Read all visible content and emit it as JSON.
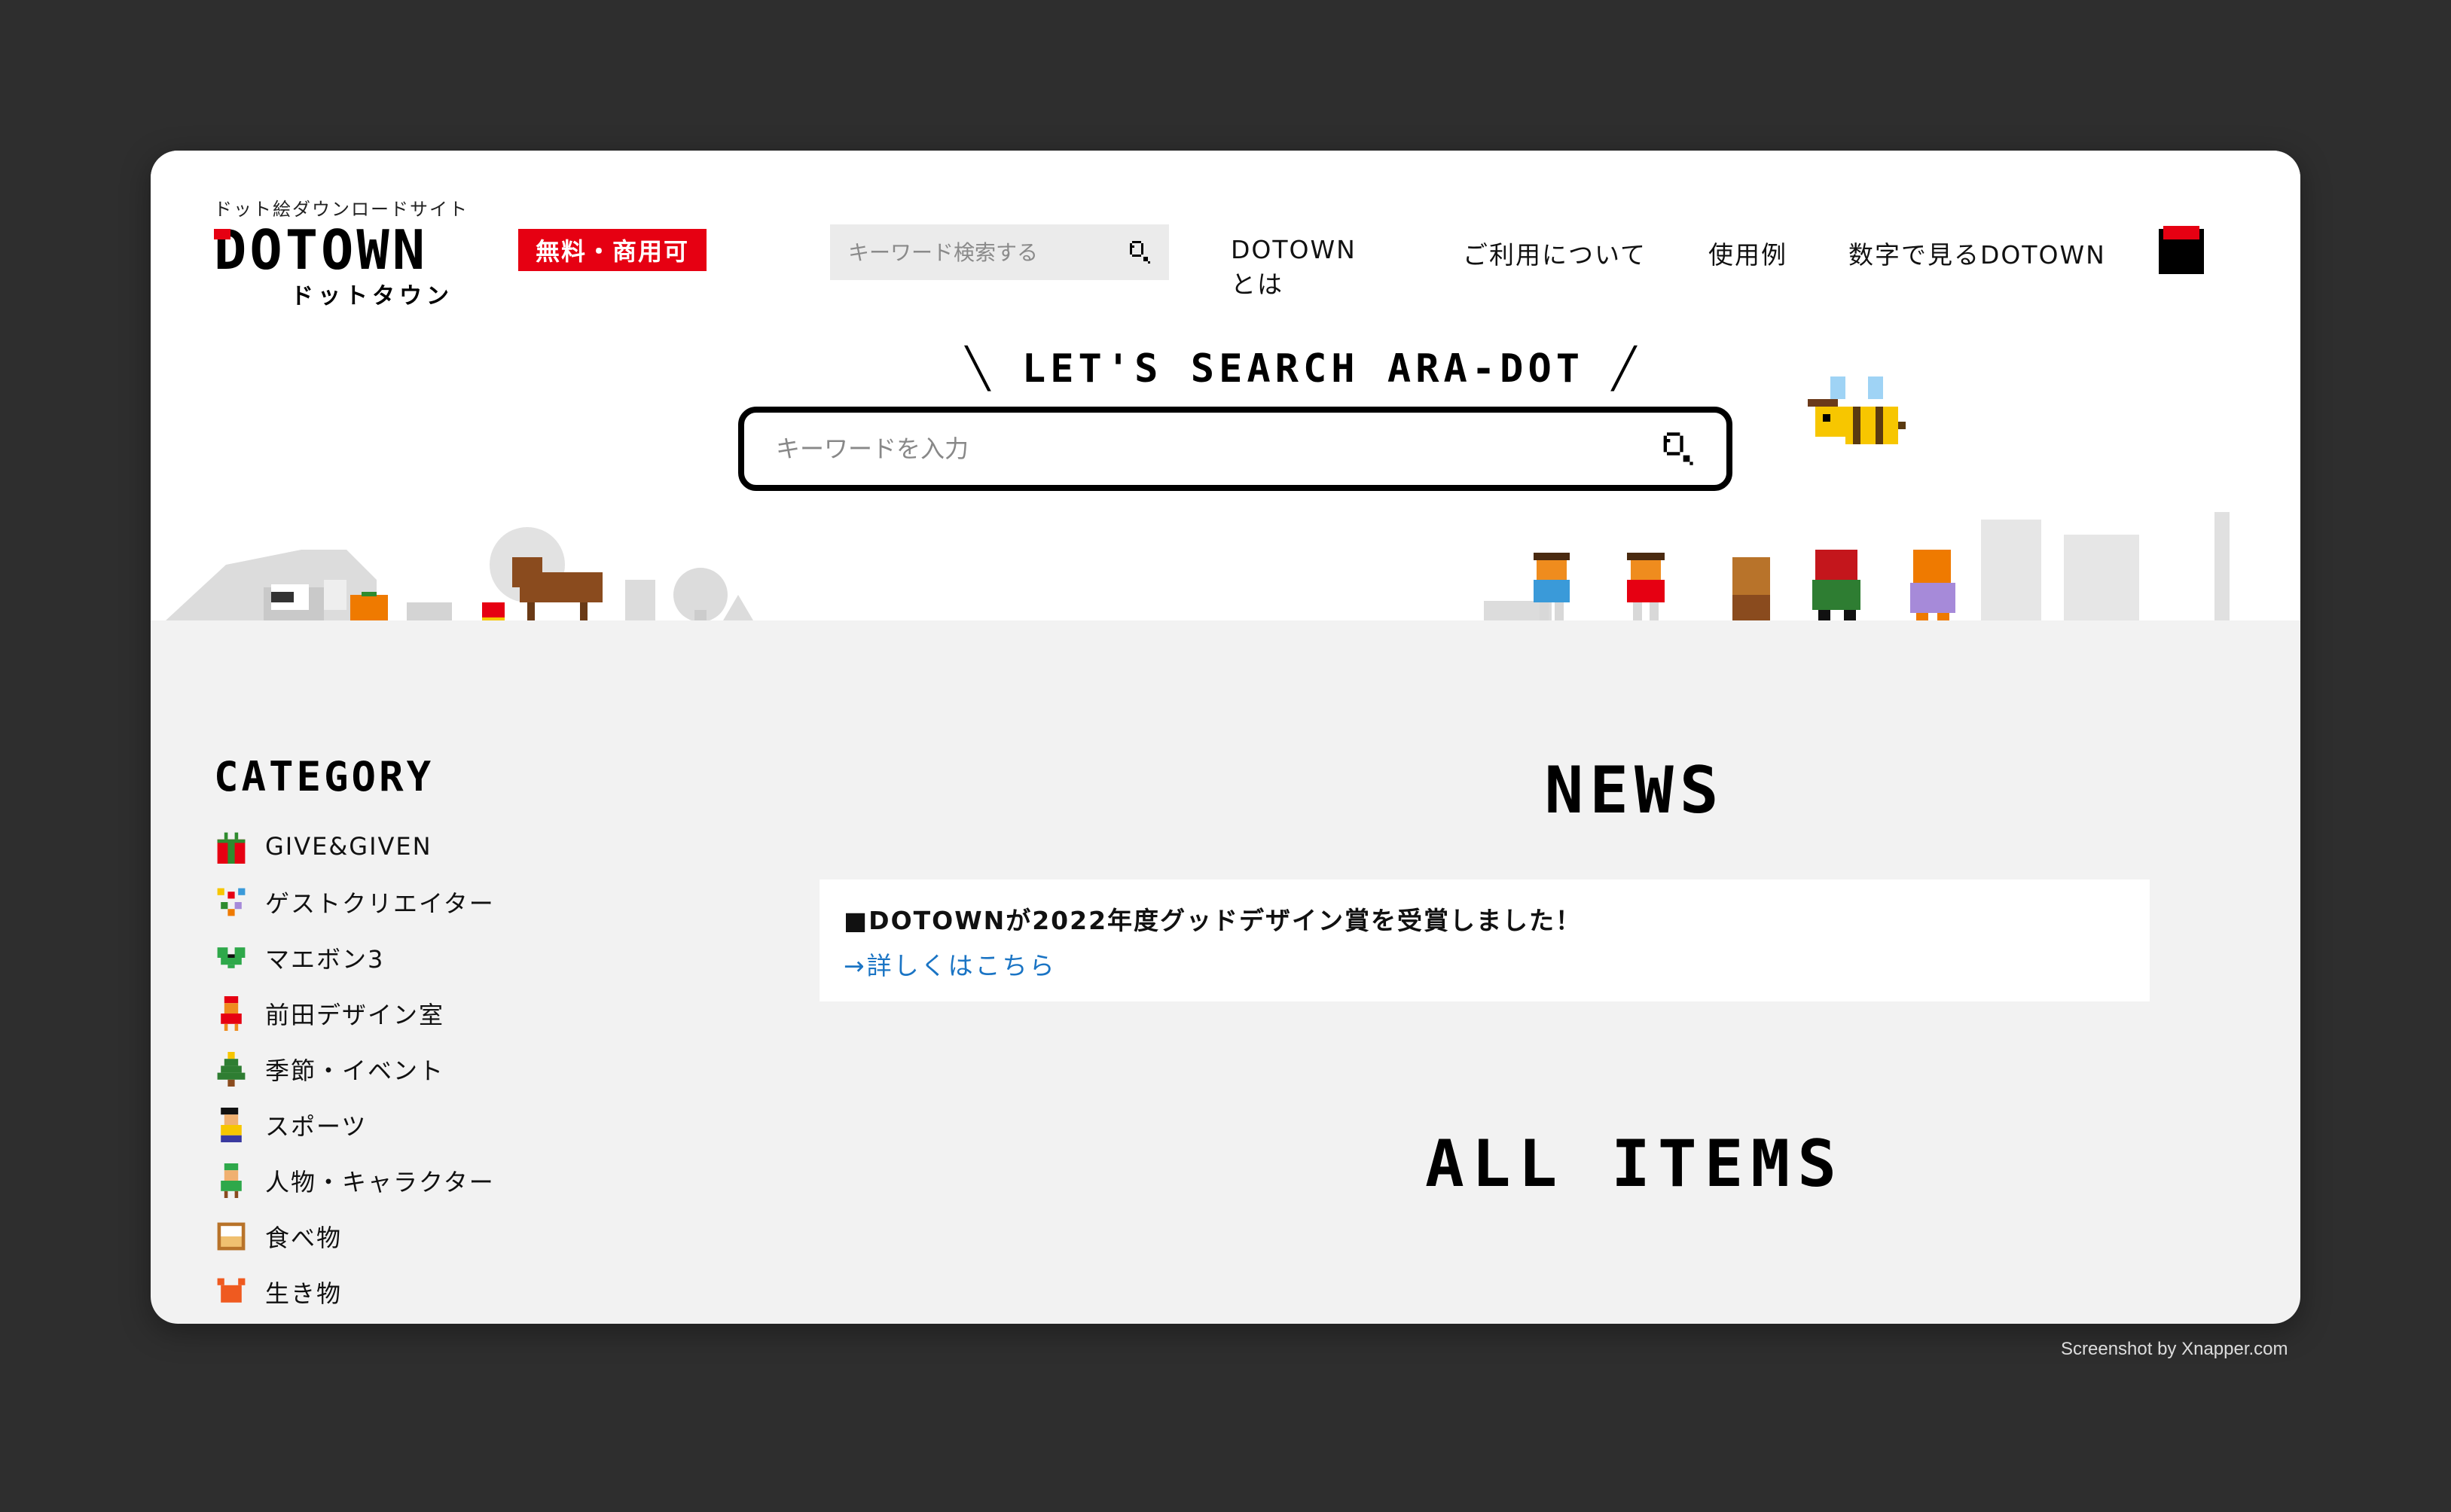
{
  "header": {
    "tagline": "ドット絵ダウンロードサイト",
    "logo": "DOTOWN",
    "logo_kana": "ドットタウン",
    "badge": "無料・商用可",
    "search_placeholder": "キーワード検索する",
    "nav": [
      "DOTOWNとは",
      "ご利用について",
      "使用例",
      "数字で見るDOTOWN"
    ]
  },
  "hero": {
    "tagline": "LET'S SEARCH ARA-DOT",
    "search_placeholder": "キーワードを入力"
  },
  "sidebar": {
    "title": "CATEGORY",
    "items": [
      {
        "label": "GIVE&GIVEN",
        "icon": "gift-icon"
      },
      {
        "label": "ゲストクリエイター",
        "icon": "guest-creator-icon"
      },
      {
        "label": "マエボン3",
        "icon": "heart-icon"
      },
      {
        "label": "前田デザイン室",
        "icon": "person-icon"
      },
      {
        "label": "季節・イベント",
        "icon": "tree-icon"
      },
      {
        "label": "スポーツ",
        "icon": "sports-icon"
      },
      {
        "label": "人物・キャラクター",
        "icon": "character-icon"
      },
      {
        "label": "食べ物",
        "icon": "food-icon"
      },
      {
        "label": "生き物",
        "icon": "animal-icon"
      }
    ]
  },
  "news": {
    "title": "NEWS",
    "headline": "■DOTOWNが2022年度グッドデザイン賞を受賞しました！",
    "link": "→詳しくはこちら"
  },
  "all_items": {
    "title": "ALL ITEMS"
  },
  "credit": "Screenshot by Xnapper.com",
  "colors": {
    "accent_red": "#e60012",
    "link_blue": "#1a74c4",
    "panel_bg": "#f2f2f2"
  }
}
